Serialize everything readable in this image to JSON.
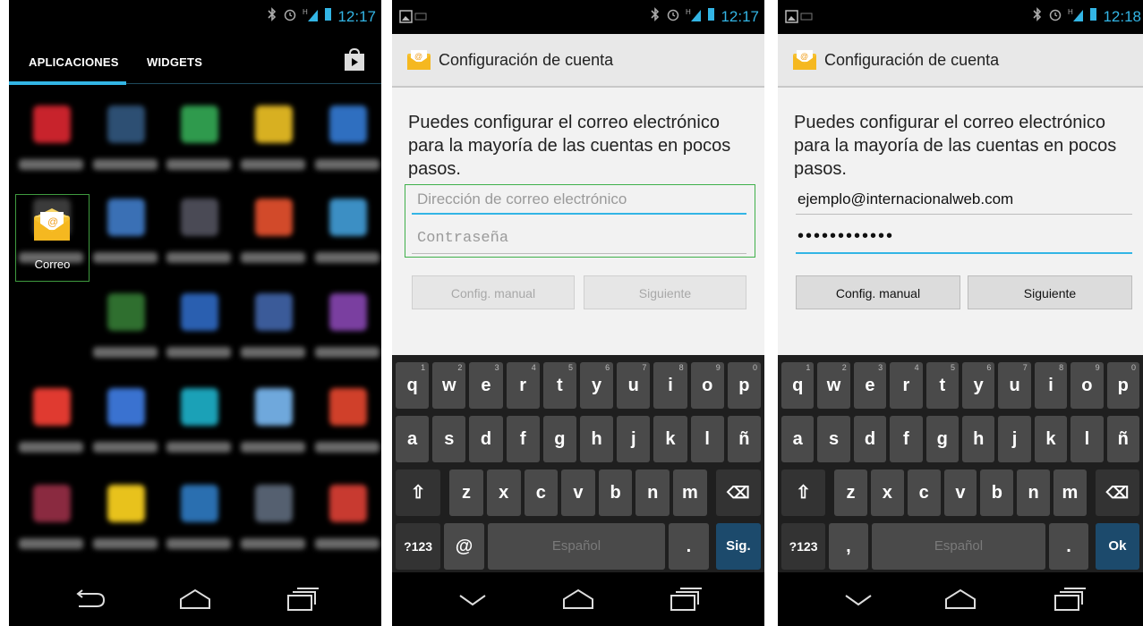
{
  "screen1": {
    "status": {
      "time": "12:17"
    },
    "tabs": [
      "APLICACIONES",
      "WIDGETS"
    ],
    "selected_app_label": "Correo",
    "apps_blurred": [
      "Adobe Reader",
      "Ajustes",
      "Ajustes de Google",
      "Asesorio Frío",
      "Búsqueda por voz",
      "Calculadora",
      "Calendario",
      "Cámara",
      "Chrome",
      "Contactos",
      "Correo",
      "Descargas",
      "Earth",
      "Facebook",
      "Galería",
      "Gmail",
      "Google",
      "Google Currents",
      "Google Talk",
      "Google+",
      "Hostelería Salamanca",
      "IMDb",
      "LinkedIn",
      "Linterna",
      "Local"
    ],
    "icons": [
      "bluetooth-icon",
      "alarm-icon",
      "signal-icon",
      "battery-icon",
      "play-store-icon",
      "back-icon",
      "home-icon",
      "recent-apps-icon"
    ]
  },
  "screen2": {
    "status": {
      "time": "12:17"
    },
    "title": "Configuración de cuenta",
    "intro": "Puedes configurar el correo electrónico para la mayoría de las cuentas en pocos pasos.",
    "email_placeholder": "Dirección de correo electrónico",
    "password_placeholder": "Contraseña",
    "btn_manual": "Config. manual",
    "btn_next": "Siguiente",
    "kb": {
      "space": "Español",
      "num": "?123",
      "sym": "@",
      "action": "Sig.",
      "dot": "."
    }
  },
  "screen3": {
    "status": {
      "time": "12:18"
    },
    "title": "Configuración de cuenta",
    "intro": "Puedes configurar el correo electrónico para la mayoría de las cuentas en pocos pasos.",
    "email_value": "ejemplo@internacionalweb.com",
    "password_mask": "••••••••••••",
    "btn_manual": "Config. manual",
    "btn_next": "Siguiente",
    "kb": {
      "space": "Español",
      "num": "?123",
      "sym": ",",
      "action": "Ok",
      "dot": "."
    }
  },
  "keyboard_rows": {
    "row1": [
      "q",
      "w",
      "e",
      "r",
      "t",
      "y",
      "u",
      "i",
      "o",
      "p"
    ],
    "row1_hints": [
      "1",
      "2",
      "3",
      "4",
      "5",
      "6",
      "7",
      "8",
      "9",
      "0"
    ],
    "row2": [
      "a",
      "s",
      "d",
      "f",
      "g",
      "h",
      "j",
      "k",
      "l",
      "ñ"
    ],
    "row3": [
      "z",
      "x",
      "c",
      "v",
      "b",
      "n",
      "m"
    ]
  },
  "colors": {
    "accent": "#33b5e5",
    "focus_green": "#3f9b3f",
    "action_key": "#1c4a6c"
  }
}
